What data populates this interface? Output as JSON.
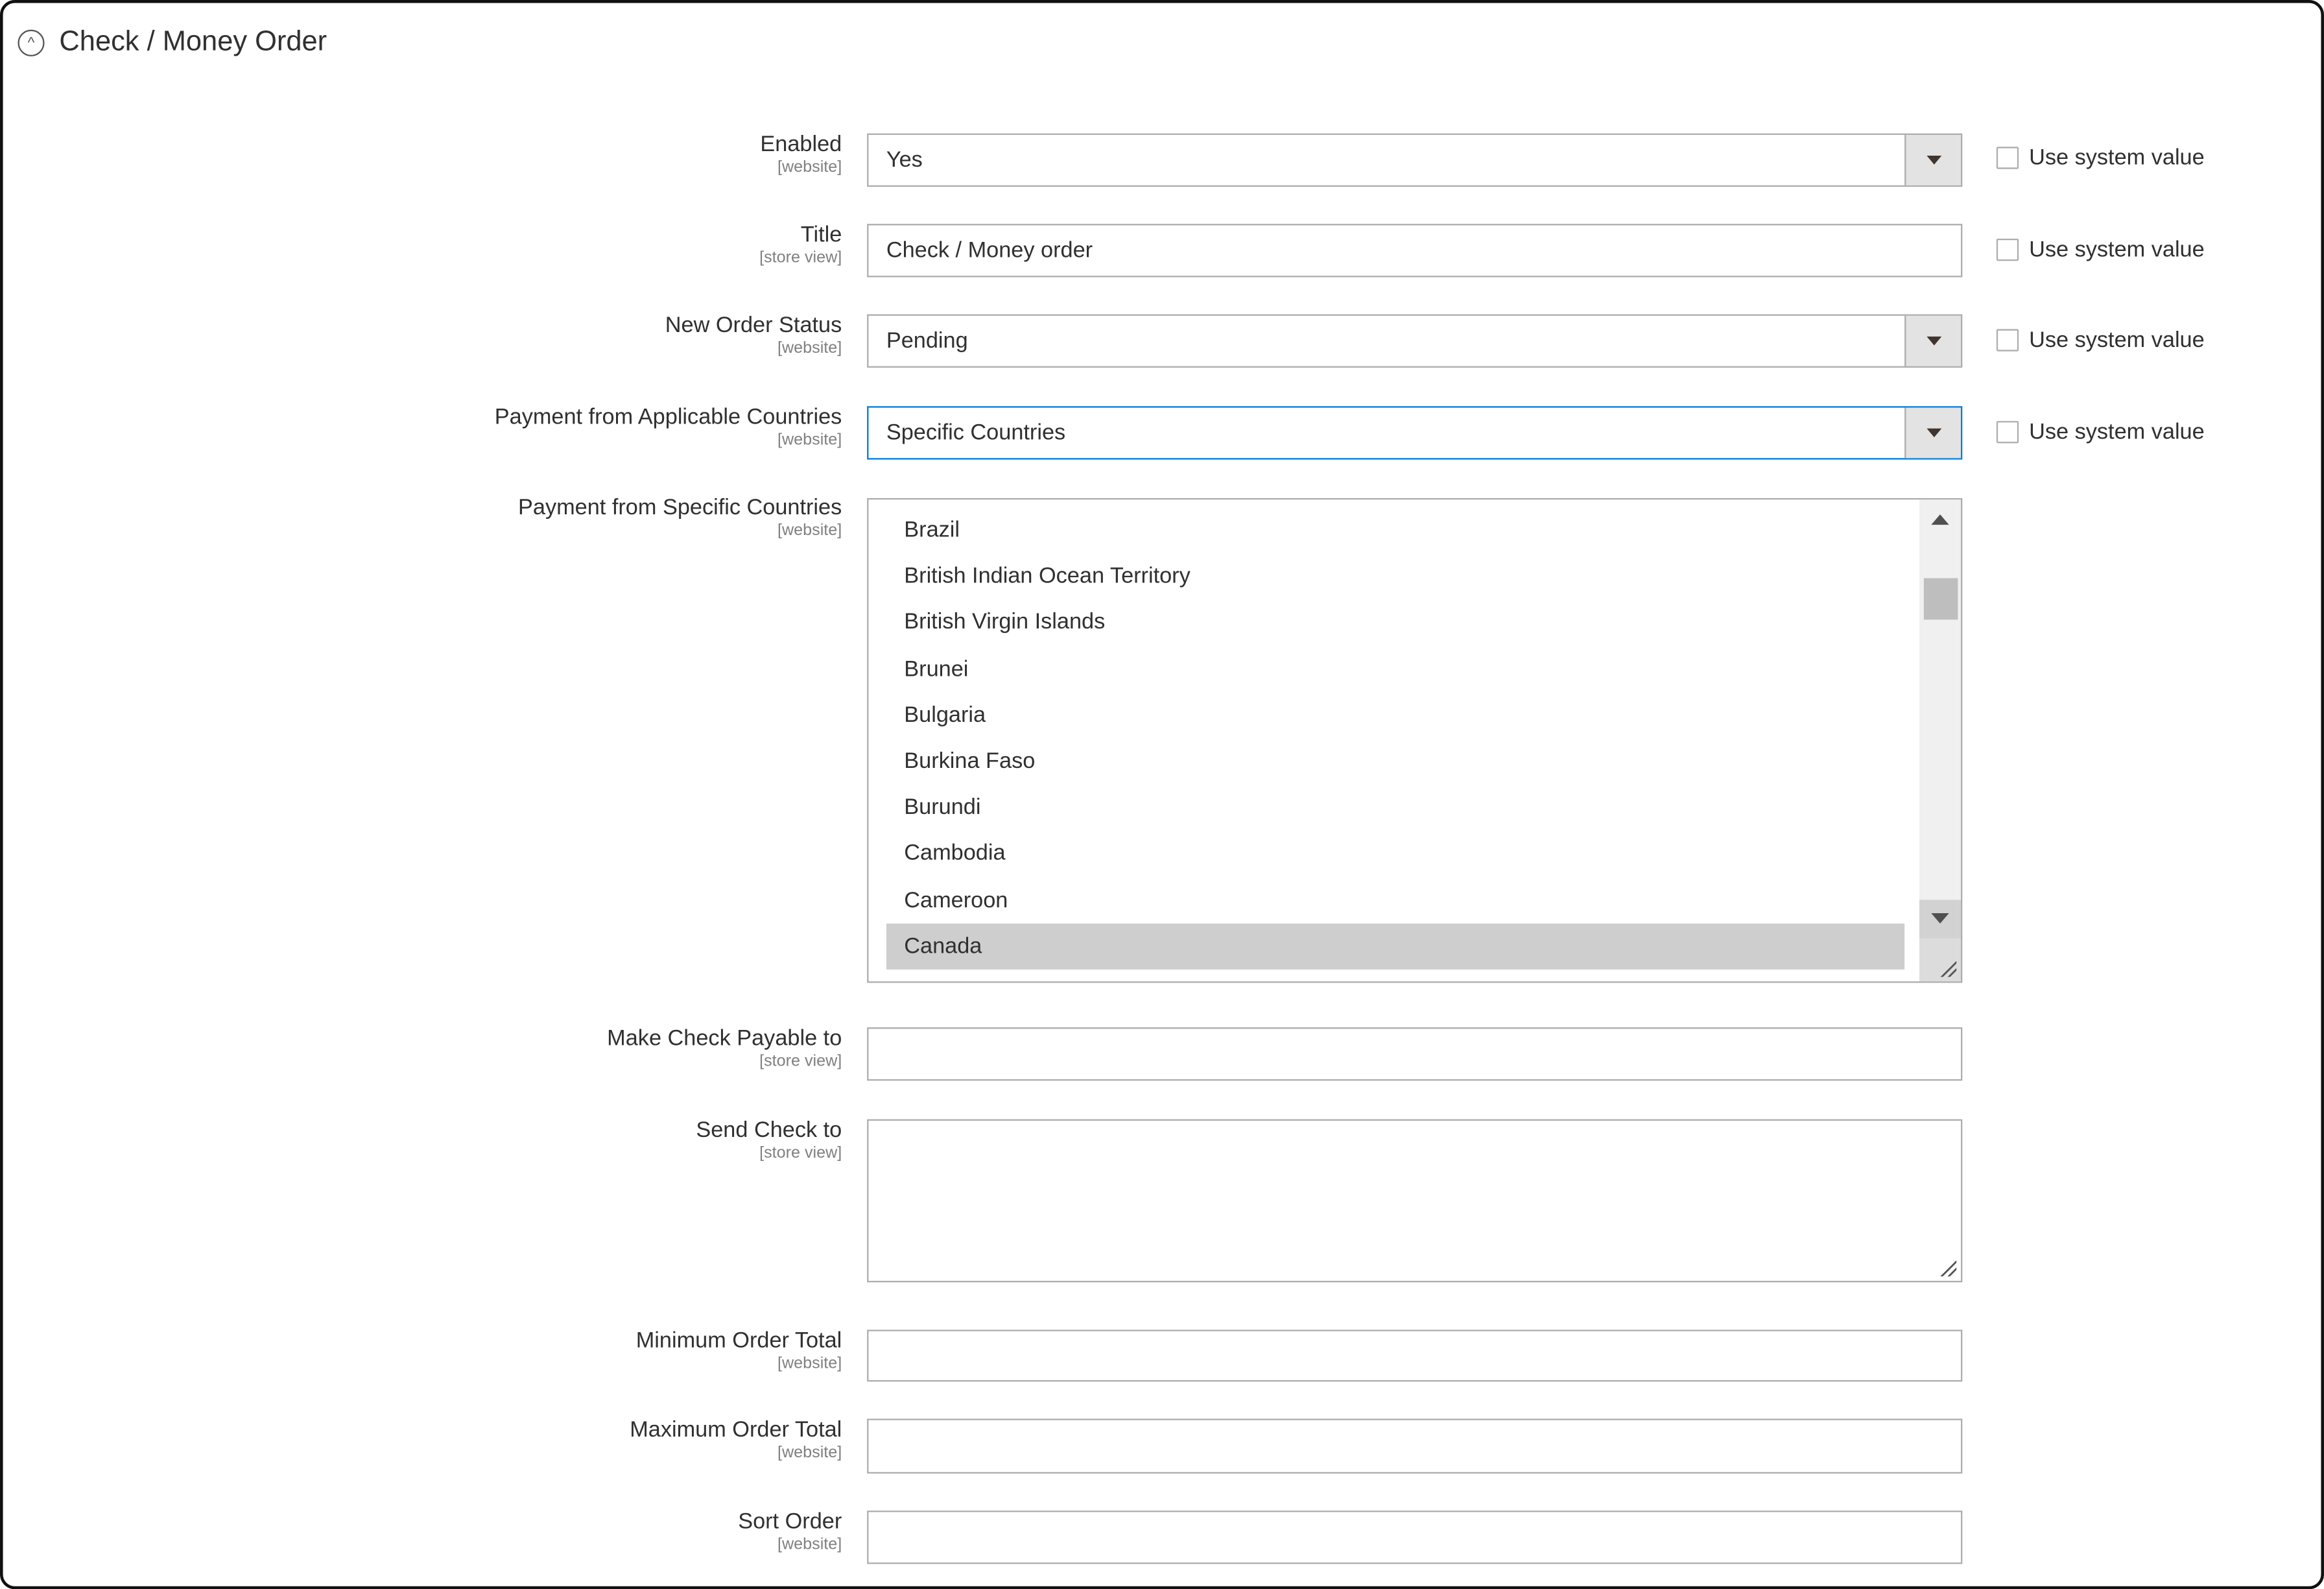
{
  "section": {
    "title": "Check / Money Order",
    "icon": "collapse-chevron-up-icon"
  },
  "use_system_value_label": "Use system value",
  "fields": {
    "enabled": {
      "label": "Enabled",
      "scope": "[website]",
      "value": "Yes"
    },
    "title": {
      "label": "Title",
      "scope": "[store view]",
      "value": "Check / Money order"
    },
    "new_order_status": {
      "label": "New Order Status",
      "scope": "[website]",
      "value": "Pending"
    },
    "applicable_countries": {
      "label": "Payment from Applicable Countries",
      "scope": "[website]",
      "value": "Specific Countries"
    },
    "specific_countries": {
      "label": "Payment from Specific Countries",
      "scope": "[website]",
      "options": [
        "Brazil",
        "British Indian Ocean Territory",
        "British Virgin Islands",
        "Brunei",
        "Bulgaria",
        "Burkina Faso",
        "Burundi",
        "Cambodia",
        "Cameroon",
        "Canada"
      ],
      "selected": "Canada"
    },
    "payable_to": {
      "label": "Make Check Payable to",
      "scope": "[store view]",
      "value": ""
    },
    "send_to": {
      "label": "Send Check to",
      "scope": "[store view]",
      "value": ""
    },
    "min_total": {
      "label": "Minimum Order Total",
      "scope": "[website]",
      "value": ""
    },
    "max_total": {
      "label": "Maximum Order Total",
      "scope": "[website]",
      "value": ""
    },
    "sort_order": {
      "label": "Sort Order",
      "scope": "[website]",
      "value": ""
    }
  },
  "colors": {
    "focus_border": "#007bdb",
    "selected_option": "#cecece"
  }
}
